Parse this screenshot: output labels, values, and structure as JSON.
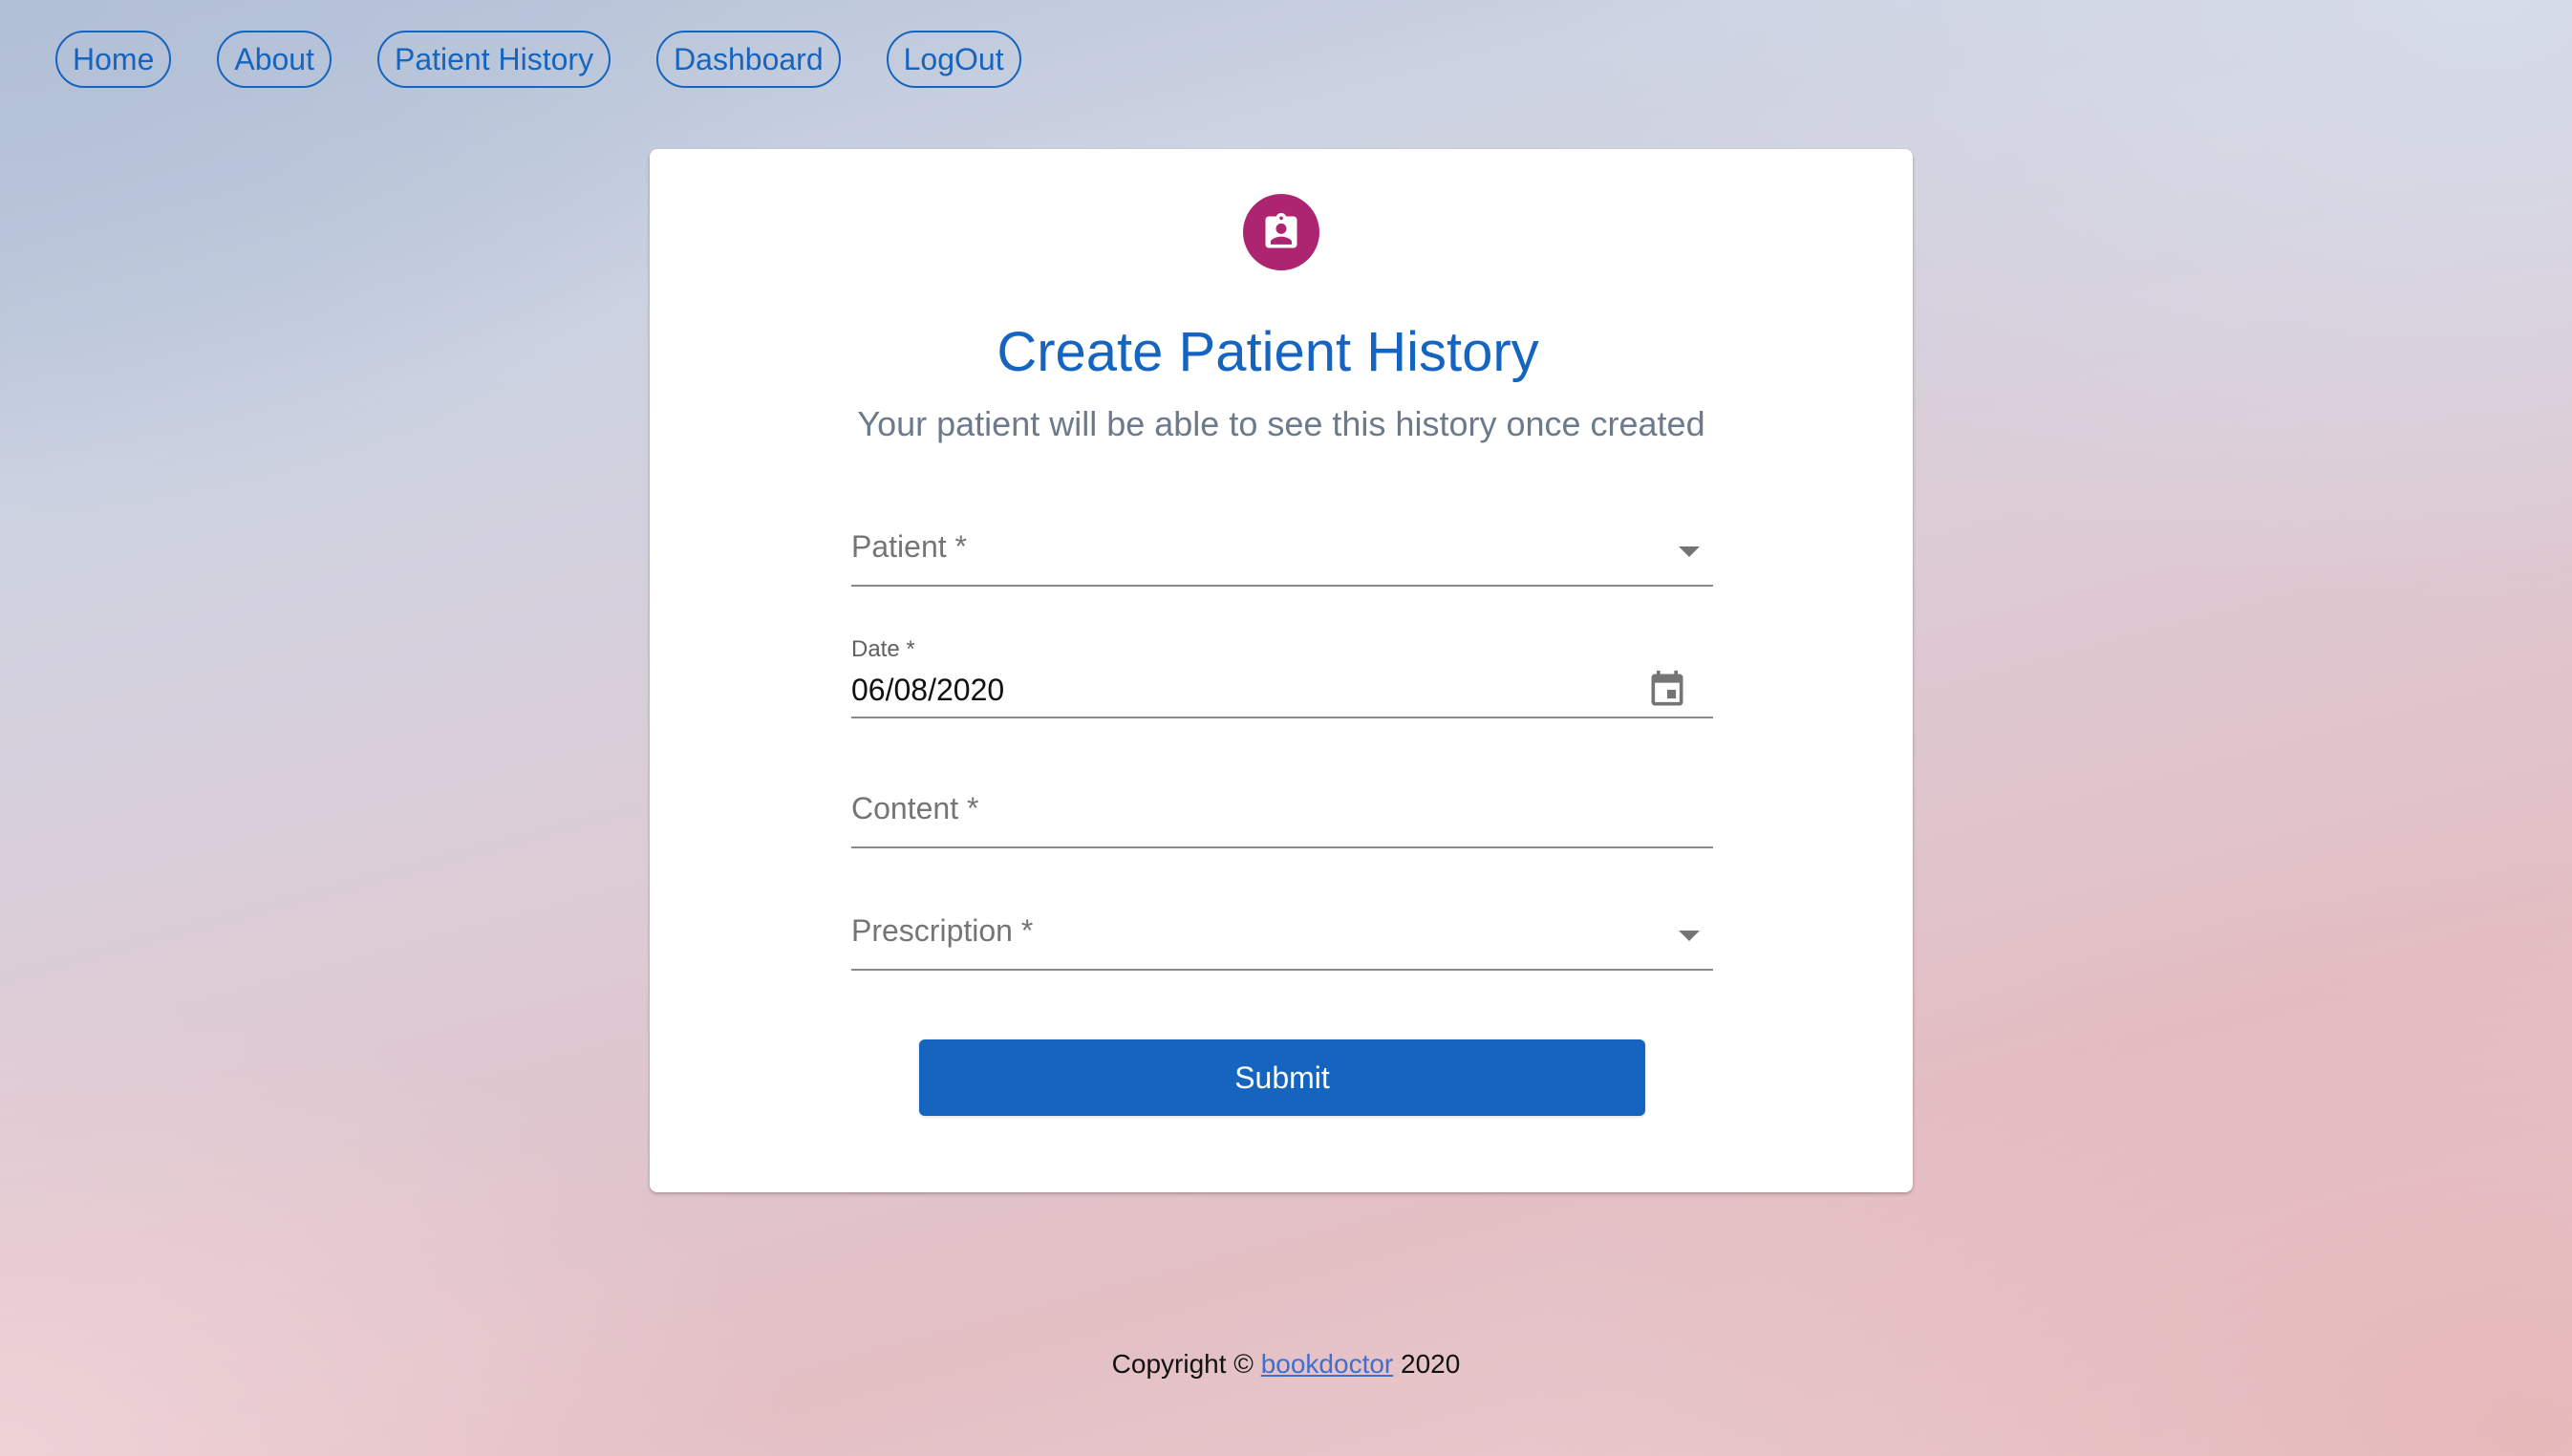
{
  "nav": {
    "items": [
      {
        "label": "Home"
      },
      {
        "label": "About"
      },
      {
        "label": "Patient History"
      },
      {
        "label": "Dashboard"
      },
      {
        "label": "LogOut"
      }
    ]
  },
  "card": {
    "icon": "assignment-ind-icon",
    "title": "Create Patient History",
    "subtitle": "Your patient will be able to see this history once created"
  },
  "form": {
    "patient": {
      "label": "Patient *",
      "value": ""
    },
    "date": {
      "label": "Date *",
      "value": "06/08/2020"
    },
    "content": {
      "label": "Content *",
      "value": ""
    },
    "prescription": {
      "label": "Prescription *",
      "value": ""
    },
    "submit_label": "Submit"
  },
  "footer": {
    "prefix": "Copyright ©",
    "link": "bookdoctor",
    "year": "2020"
  },
  "colors": {
    "primary": "#1565c0",
    "avatar": "#ad2471",
    "subtitle": "#6b7b8c"
  }
}
